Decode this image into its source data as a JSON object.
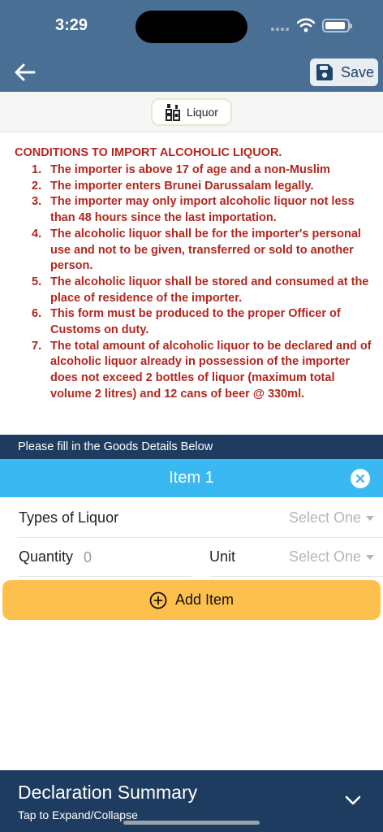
{
  "status_bar": {
    "time": "3:29"
  },
  "toolbar": {
    "save_label": "Save"
  },
  "category_chip": {
    "label": "Liquor"
  },
  "conditions": {
    "title": "CONDITIONS TO IMPORT ALCOHOLIC LIQUOR.",
    "items": [
      {
        "num": "1.",
        "text": "The importer is above 17 of age and a non-Muslim"
      },
      {
        "num": "2.",
        "text": "The importer enters Brunei Darussalam legally."
      },
      {
        "num": "3.",
        "text": "The importer may only import alcoholic liquor not less than 48 hours since the last importation."
      },
      {
        "num": "4.",
        "text": "The alcoholic liquor shall be for the importer's personal use and not to be given, transferred or sold to another person."
      },
      {
        "num": "5.",
        "text": "The alcoholic liquor shall be stored and consumed at the place of residence of the importer."
      },
      {
        "num": "6.",
        "text": "This form must be produced to the proper Officer of Customs on duty."
      },
      {
        "num": "7.",
        "text": "The total amount of alcoholic liquor to be declared and of alcoholic liquor already in possession of the importer does not exceed 2 bottles of liquor (maximum total volume 2 litres) and 12 cans of beer @ 330ml."
      }
    ]
  },
  "goods_section": {
    "header": "Please fill in the Goods Details Below"
  },
  "item": {
    "title": "Item 1",
    "type_label": "Types of Liquor",
    "type_value": "Select One",
    "quantity_label": "Quantity",
    "quantity_placeholder": "0",
    "unit_label": "Unit",
    "unit_value": "Select One"
  },
  "add_item": {
    "label": "Add Item"
  },
  "summary": {
    "title": "Declaration Summary",
    "subtitle": "Tap to Expand/Collapse"
  },
  "colors": {
    "header": "#4a6f94",
    "navy": "#1e3c60",
    "item_bar": "#39b8f1",
    "conditions_text": "#b3261e",
    "add_button": "#fec04c"
  }
}
